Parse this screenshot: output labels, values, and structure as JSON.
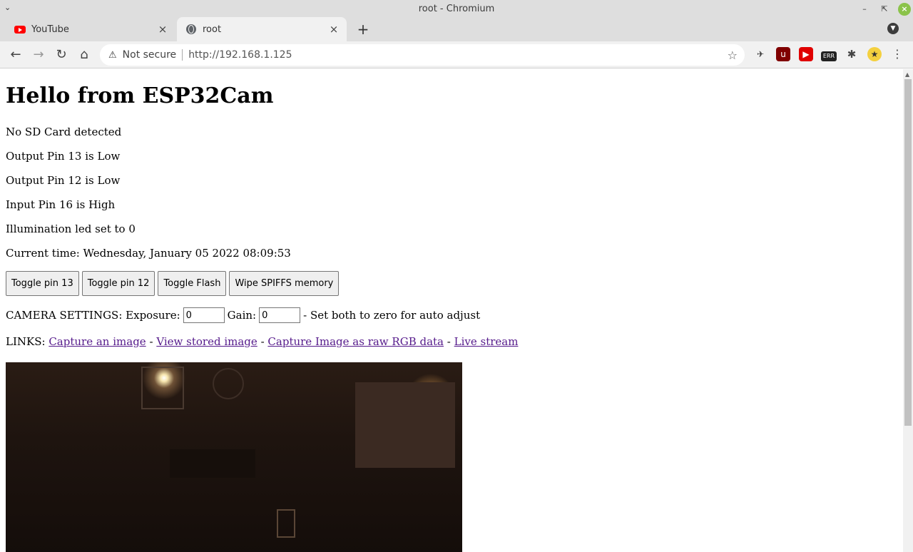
{
  "window": {
    "title": "root - Chromium"
  },
  "tabs": [
    {
      "label": "YouTube",
      "icon": "youtube-icon"
    },
    {
      "label": "root",
      "icon": "globe-icon"
    }
  ],
  "toolbar": {
    "security_label": "Not secure",
    "url": "http://192.168.1.125"
  },
  "extensions": {
    "err_badge": "ERR"
  },
  "page": {
    "heading": "Hello from ESP32Cam",
    "status_lines": [
      "No SD Card detected",
      "Output Pin 13 is Low",
      "Output Pin 12 is Low",
      "Input Pin 16 is High",
      "Illumination led set to 0",
      "Current time: Wednesday, January 05 2022 08:09:53"
    ],
    "buttons": [
      "Toggle pin 13",
      "Toggle pin 12",
      "Toggle Flash",
      "Wipe SPIFFS memory"
    ],
    "camera_settings": {
      "prefix": "CAMERA SETTINGS: Exposure:",
      "exposure_value": "0",
      "gain_label": "Gain:",
      "gain_value": "0",
      "suffix": "- Set both to zero for auto adjust"
    },
    "links": {
      "prefix": "LINKS:",
      "sep": "-",
      "items": [
        "Capture an image",
        "View stored image",
        "Capture Image as raw RGB data",
        "Live stream"
      ]
    }
  }
}
